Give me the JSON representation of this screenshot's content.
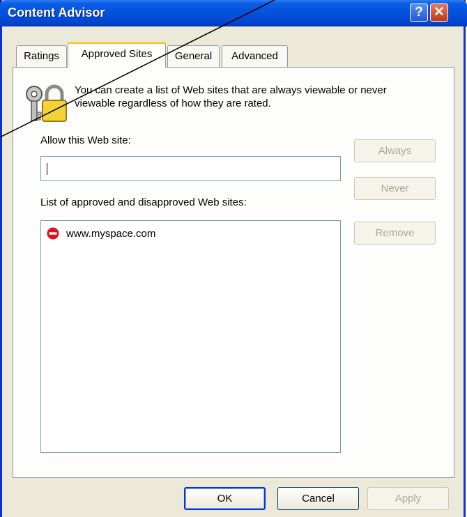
{
  "window": {
    "title": "Content Advisor",
    "help_icon": "?",
    "close_icon": "✕"
  },
  "tabs": [
    {
      "label": "Ratings",
      "active": false
    },
    {
      "label": "Approved Sites",
      "active": true
    },
    {
      "label": "General",
      "active": false
    },
    {
      "label": "Advanced",
      "active": false
    }
  ],
  "approved_sites": {
    "description": "You can create a list of Web sites that are always viewable or never viewable regardless of how they are rated.",
    "allow_label": "Allow this Web site:",
    "allow_value": "",
    "list_label": "List of approved and disapproved Web sites:",
    "sites": [
      {
        "url": "www.myspace.com",
        "status": "never",
        "icon": "block-icon"
      }
    ],
    "buttons": {
      "always": "Always",
      "never": "Never",
      "remove": "Remove"
    }
  },
  "footer": {
    "ok": "OK",
    "cancel": "Cancel",
    "apply": "Apply"
  },
  "colors": {
    "titlebar": "#0451dc",
    "dialog_bg": "#ece9d8",
    "active_tab_accent": "#ffc83c",
    "block_red": "#e0101a"
  }
}
